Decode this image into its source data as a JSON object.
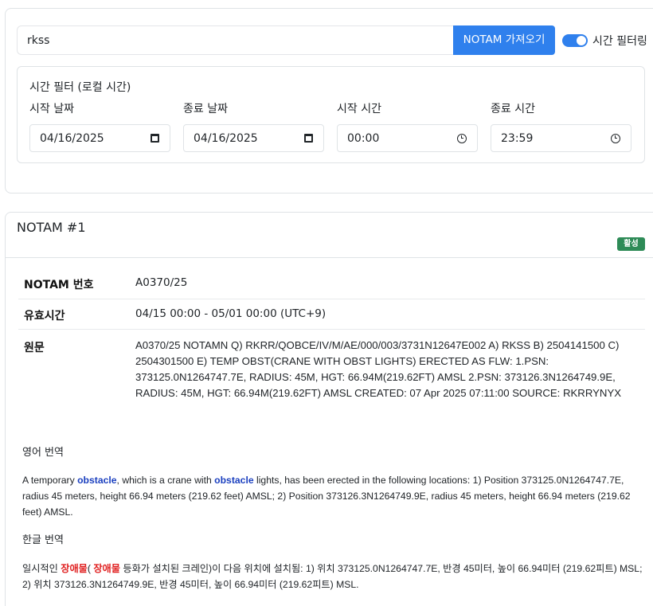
{
  "search": {
    "value": "rkss",
    "fetch_label": "NOTAM 가져오기",
    "toggle_label": "시간 필터링",
    "toggle_on": true
  },
  "filter": {
    "title": "시간 필터 (로컬 시간)",
    "fields": [
      {
        "label": "시작 날짜",
        "value": "04/16/2025",
        "icon": "calendar-icon"
      },
      {
        "label": "종료 날짜",
        "value": "04/16/2025",
        "icon": "calendar-icon"
      },
      {
        "label": "시작 시간",
        "value": "00:00",
        "icon": "clock-icon"
      },
      {
        "label": "종료 시간",
        "value": "23:59",
        "icon": "clock-icon"
      }
    ]
  },
  "notam": {
    "title": "NOTAM #1",
    "status": "활성",
    "colors": {
      "accent": "#2f80ed",
      "badge": "#2e8b57",
      "highlight_en": "#1a3fbf",
      "highlight_ko": "#e02020"
    },
    "rows": [
      {
        "key": "NOTAM 번호",
        "value": "A0370/25"
      },
      {
        "key": "유효시간",
        "value": "04/15 00:00 - 05/01 00:00 (UTC+9)"
      },
      {
        "key": "원문",
        "value": "A0370/25 NOTAMN Q) RKRR/QOBCE/IV/M/AE/000/003/3731N12647E002 A) RKSS B) 2504141500 C) 2504301500 E) TEMP OBST(CRANE WITH OBST LIGHTS) ERECTED AS FLW: 1.PSN: 373125.0N1264747.7E, RADIUS: 45M, HGT: 66.94M(219.62FT) AMSL 2.PSN: 373126.3N1264749.9E, RADIUS: 45M, HGT: 66.94M(219.62FT) AMSL CREATED: 07 Apr 2025 07:11:00 SOURCE: RKRRYNYX"
      }
    ],
    "english_label": "영어 번역",
    "english": {
      "p1": "A temporary ",
      "h1": "obstacle",
      "p2": ", which is a crane with ",
      "h2": "obstacle",
      "p3": " lights, has been erected in the following locations: 1) Position 373125.0N1264747.7E, radius 45 meters, height 66.94 meters (219.62 feet) AMSL; 2) Position 373126.3N1264749.9E, radius 45 meters, height 66.94 meters (219.62 feet) AMSL."
    },
    "korean_label": "한글 번역",
    "korean": {
      "p1": "일시적인 ",
      "h1": "장애물",
      "p2": "( ",
      "h2": "장애물",
      "p3": " 등화가 설치된 크레인)이 다음 위치에 설치됨: 1) 위치 373125.0N1264747.7E, 반경 45미터, 높이 66.94미터 (219.62피트) MSL; 2) 위치 373126.3N1264749.9E, 반경 45미터, 높이 66.94미터 (219.62피트) MSL."
    }
  }
}
